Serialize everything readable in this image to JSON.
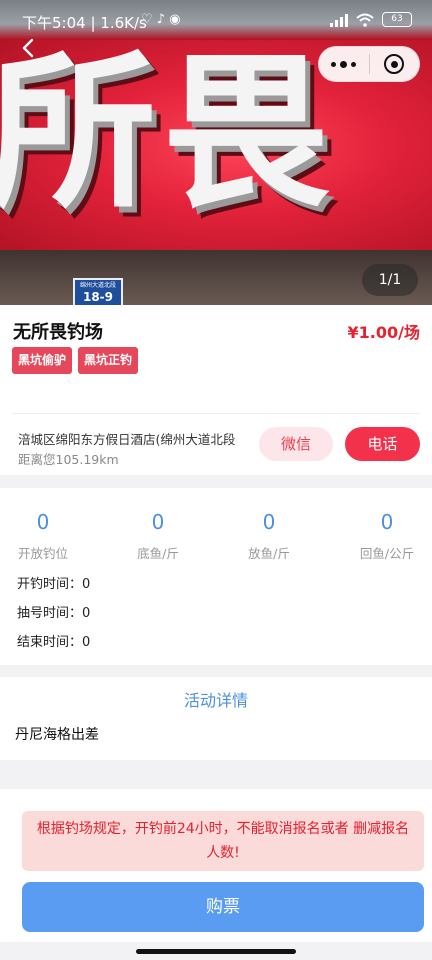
{
  "status_bar": {
    "time_speed": "下午5:04 | 1.6K/s",
    "app_icons": "♡ ♪ ◉",
    "battery": "63"
  },
  "hero": {
    "sign_text": "所畏",
    "plate_street": "绵州大道北段",
    "plate_number": "18-9",
    "image_counter": "1/1"
  },
  "venue": {
    "name": "无所畏钓场",
    "price": "¥1.00/场",
    "tags": [
      "黑坑偷驴",
      "黑坑正钓"
    ],
    "address": "涪城区绵阳东方假日酒店(绵州大道北段",
    "distance": "距离您105.19km",
    "wechat_label": "微信",
    "phone_label": "电话"
  },
  "stats": [
    {
      "value": "0",
      "label": "开放钓位"
    },
    {
      "value": "0",
      "label": "底鱼/斤"
    },
    {
      "value": "0",
      "label": "放鱼/斤"
    },
    {
      "value": "0",
      "label": "回鱼/公斤"
    }
  ],
  "times": {
    "open": "开钓时间：0",
    "draw": "抽号时间：0",
    "end": "结束时间：0"
  },
  "activity": {
    "title": "活动详情",
    "content": "丹尼海格出差"
  },
  "notice": "根据钓场规定，开钓前24小时，不能取消报名或者 删减报名人数!",
  "buy_label": "购票",
  "colors": {
    "accent_red": "#e8202f",
    "tag_red": "#e5485b",
    "stat_blue": "#4d8fe0",
    "buy_blue": "#5b9cf3",
    "notice_bg": "#fbdada"
  }
}
